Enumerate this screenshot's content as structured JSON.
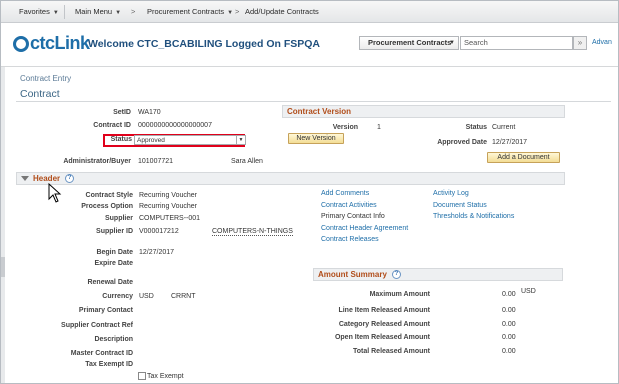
{
  "nav": {
    "favorites": "Favorites",
    "main_menu": "Main Menu",
    "procurement": "Procurement Contracts",
    "breadcrumb": "Add/Update Contracts"
  },
  "header": {
    "logo": "ctcLink",
    "welcome": "Welcome CTC_BCABILING Logged On FSPQA",
    "search_select": "Procurement Contracts",
    "search_placeholder": "Search",
    "advanced": "Advan"
  },
  "page": {
    "subtitle": "Contract Entry",
    "title": "Contract"
  },
  "fields": {
    "setid_label": "SetID",
    "setid": "WA170",
    "contract_id_label": "Contract ID",
    "contract_id": "0000000000000000007",
    "status_label": "Status",
    "status": "Approved",
    "admin_label": "Administrator/Buyer",
    "admin_id": "101007721",
    "admin_name": "Sara Allen"
  },
  "version": {
    "section": "Contract Version",
    "version_label": "Version",
    "version": "1",
    "status_label": "Status",
    "status": "Current",
    "new_version": "New Version",
    "approved_label": "Approved Date",
    "approved_date": "12/27/2017",
    "add_doc": "Add a Document"
  },
  "header_section": {
    "title": "Header"
  },
  "hdr": {
    "style_label": "Contract Style",
    "style": "Recurring Voucher",
    "process_label": "Process Option",
    "process": "Recurring Voucher",
    "supplier_label": "Supplier",
    "supplier": "COMPUTERS--001",
    "supplier_id_label": "Supplier ID",
    "supplier_id": "V000017212",
    "supplier_name": "COMPUTERS-N-THINGS",
    "begin_label": "Begin Date",
    "begin": "12/27/2017",
    "expire_label": "Expire Date",
    "renewal_label": "Renewal Date",
    "currency_label": "Currency",
    "currency": "USD",
    "currency_rt": "CRRNT",
    "primary_label": "Primary Contact",
    "supref_label": "Supplier Contract Ref",
    "desc_label": "Description",
    "master_label": "Master Contract ID",
    "tax_label": "Tax Exempt ID",
    "tax_check": "Tax Exempt"
  },
  "links": {
    "add_comments": "Add Comments",
    "activity_log": "Activity Log",
    "contract_activities": "Contract Activities",
    "document_status": "Document Status",
    "primary_contact_info": "Primary Contact Info",
    "thresholds": "Thresholds & Notifications",
    "header_agreement": "Contract Header Agreement",
    "releases": "Contract Releases"
  },
  "amount": {
    "section": "Amount Summary",
    "max_label": "Maximum Amount",
    "max": "0.00",
    "currency": "USD",
    "line_label": "Line Item Released Amount",
    "line": "0.00",
    "cat_label": "Category Released Amount",
    "cat": "0.00",
    "open_label": "Open Item Released Amount",
    "open": "0.00",
    "total_label": "Total Released Amount",
    "total": "0.00"
  }
}
